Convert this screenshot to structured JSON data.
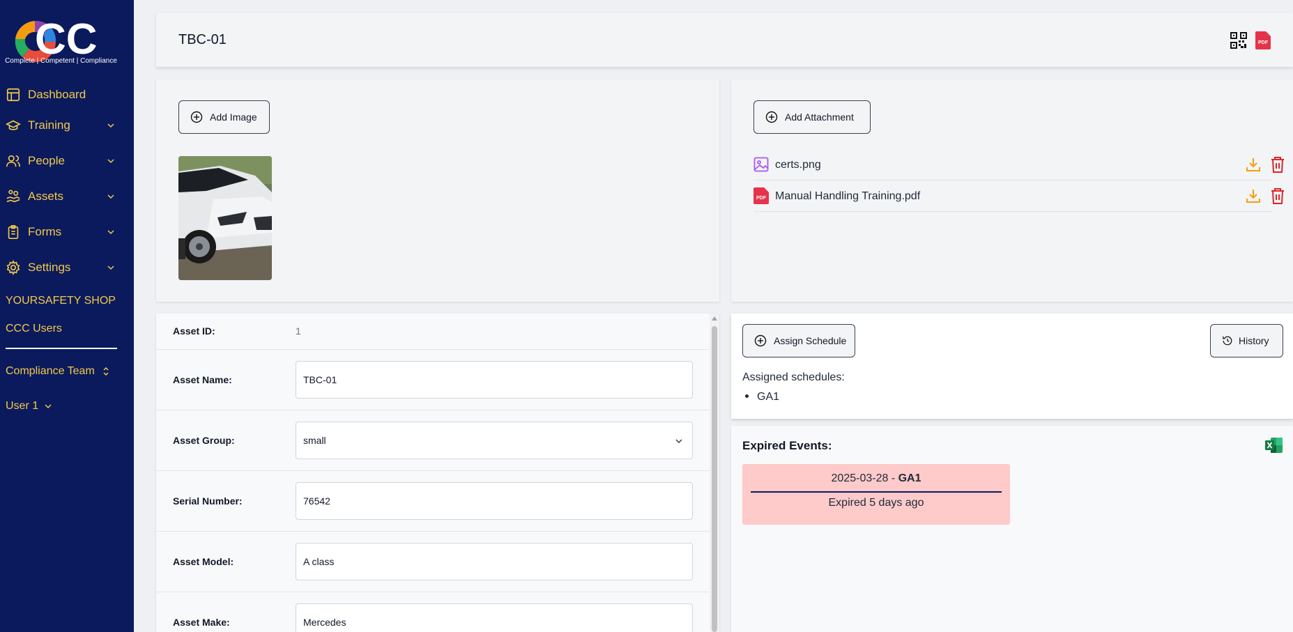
{
  "brand": {
    "logo_text": "CC",
    "tagline": "Complete | Competent | Compliance"
  },
  "sidebar": {
    "items": [
      {
        "label": "Dashboard",
        "icon": "layout-icon"
      },
      {
        "label": "Training",
        "icon": "graduation-cap-icon"
      },
      {
        "label": "People",
        "icon": "users-icon"
      },
      {
        "label": "Assets",
        "icon": "hand-coins-icon"
      },
      {
        "label": "Forms",
        "icon": "clipboard-icon"
      },
      {
        "label": "Settings",
        "icon": "gear-icon"
      }
    ],
    "org_name": "YOURSAFETY SHOP",
    "users_link": "CCC Users",
    "team_selector": "Compliance Team",
    "user_menu": "User 1",
    "accent_color": "#f2c94c",
    "background_color": "#0b1a5c"
  },
  "header": {
    "title": "TBC-01"
  },
  "images": {
    "add_label": "Add Image"
  },
  "attachments": {
    "add_label": "Add Attachment",
    "files": [
      {
        "name": "certs.png",
        "type": "image"
      },
      {
        "name": "Manual Handling Training.pdf",
        "type": "pdf"
      }
    ]
  },
  "form": {
    "asset_id": {
      "label": "Asset ID:",
      "value": "1"
    },
    "asset_name": {
      "label": "Asset Name:",
      "value": "TBC-01"
    },
    "asset_group": {
      "label": "Asset Group:",
      "value": "small"
    },
    "serial_number": {
      "label": "Serial Number:",
      "value": "76542"
    },
    "asset_model": {
      "label": "Asset Model:",
      "value": "A class"
    },
    "asset_make": {
      "label": "Asset Make:",
      "value": "Mercedes"
    }
  },
  "schedules": {
    "assign_label": "Assign Schedule",
    "history_label": "History",
    "assigned_label": "Assigned schedules:",
    "items": [
      "GA1"
    ]
  },
  "expired": {
    "title": "Expired Events:",
    "events": [
      {
        "date": "2025-03-28",
        "separator": " - ",
        "schedule": "GA1",
        "status": "Expired 5 days ago"
      }
    ],
    "card_color": "#fecaca"
  }
}
